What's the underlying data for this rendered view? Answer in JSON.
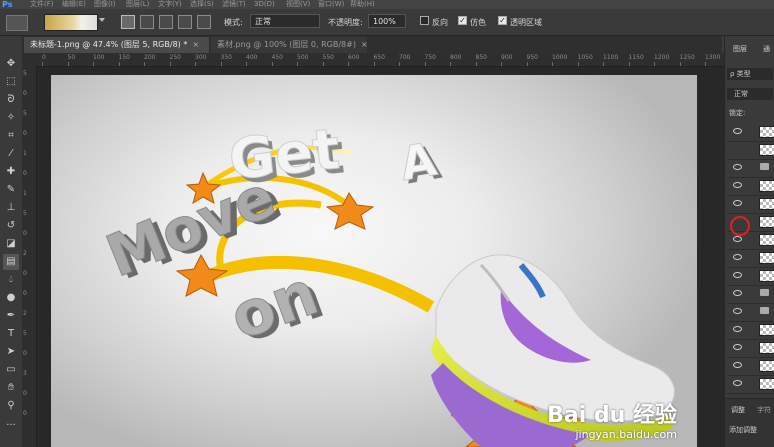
{
  "app": {
    "logo": "Ps"
  },
  "menu": [
    "文件(F)",
    "编辑(E)",
    "图像(I)",
    "图层(L)",
    "文字(Y)",
    "选择(S)",
    "滤镜(T)",
    "3D(D)",
    "视图(V)",
    "窗口(W)",
    "帮助(H)"
  ],
  "options": {
    "mode_label": "模式:",
    "mode_value": "正常",
    "opacity_label": "不透明度:",
    "opacity_value": "100%",
    "reverse_label": "反向",
    "dither_label": "仿色",
    "transparency_label": "透明区域"
  },
  "tabs": [
    {
      "label": "未标题-1.png @ 47.4% (图层 5, RGB/8) *",
      "close": "×"
    },
    {
      "label": "素材.png @ 100% (图层 0, RGB/8#)",
      "close": "×"
    }
  ],
  "ruler": {
    "top": [
      "0",
      "50",
      "100",
      "150",
      "200",
      "250",
      "300",
      "350",
      "400",
      "450",
      "500",
      "550",
      "600",
      "650",
      "700",
      "750",
      "800",
      "850",
      "900",
      "950",
      "1000",
      "1050",
      "1100",
      "1150",
      "1200",
      "1250",
      "1300"
    ],
    "left": [
      "5",
      "0",
      "5",
      "0",
      "1",
      "0",
      "1",
      "5",
      "0",
      "2",
      "0",
      "0",
      "2",
      "5",
      "0",
      "3",
      "0",
      "0"
    ]
  },
  "canvas_text": {
    "get": "Get",
    "a": "A",
    "move": "Move",
    "on": "on"
  },
  "watermark": {
    "brand": "Bai du 经验",
    "url": "jingyan.baidu.com"
  },
  "panel": {
    "tab_layers": "图层",
    "tab_channels": "通",
    "search": "ρ 类型",
    "blend": "正常",
    "lock": "锁定:",
    "bottom_tab1": "调整",
    "bottom_tab2": "字符",
    "bottom_add": "添加调整"
  }
}
